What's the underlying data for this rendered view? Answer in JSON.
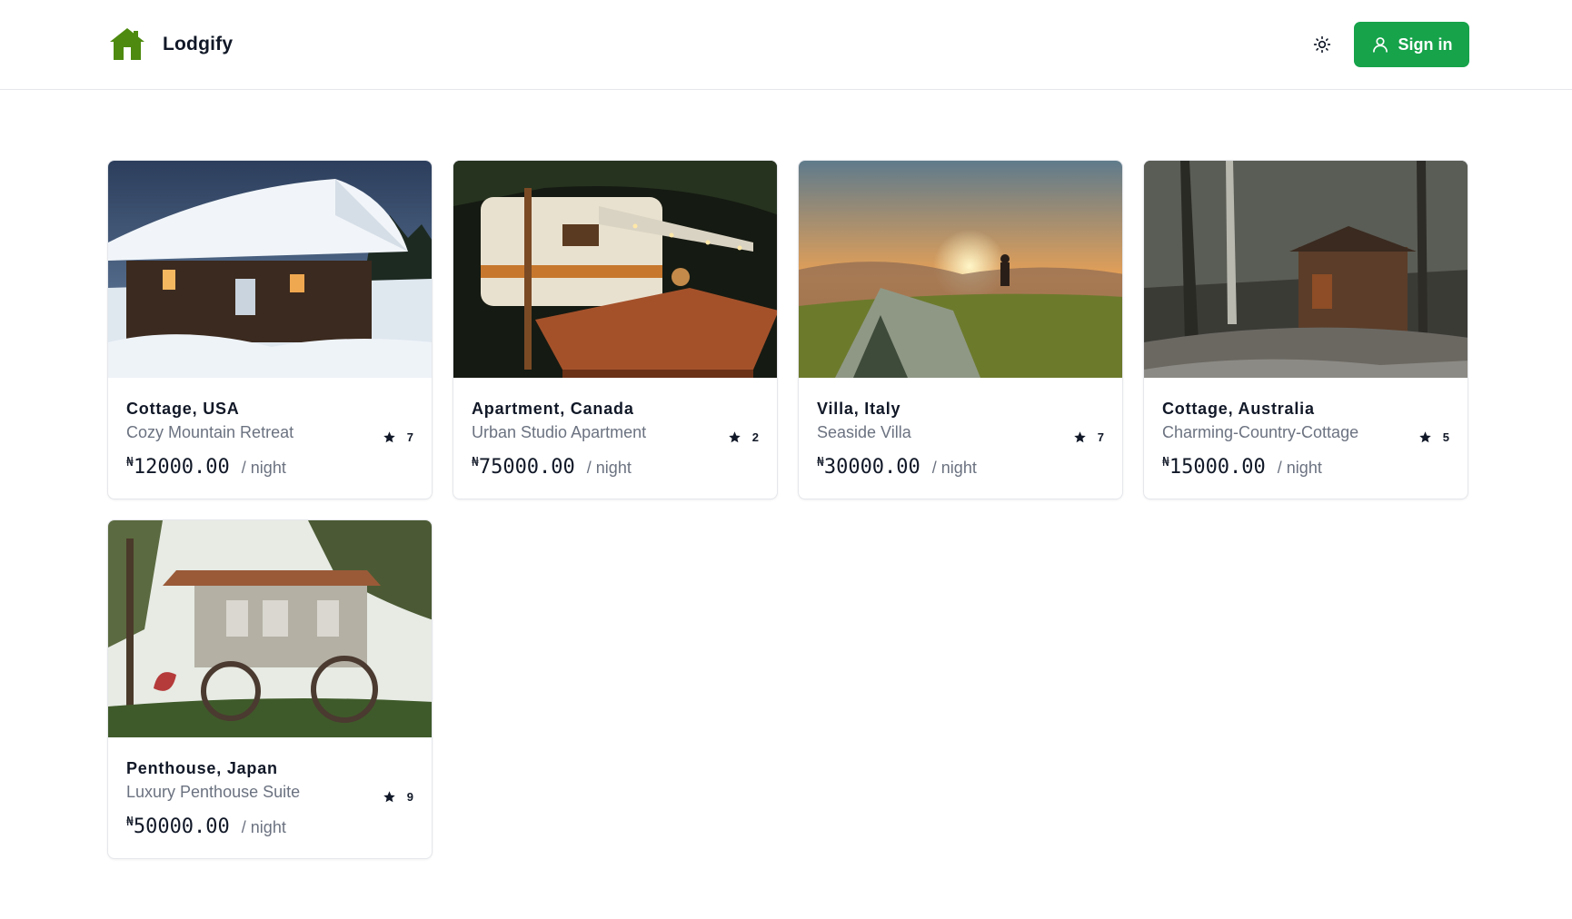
{
  "header": {
    "brand": "Lodgify",
    "signin_label": "Sign in",
    "accent_color": "#16a34a",
    "logo_icon": "house-icon",
    "theme_icon": "sun-icon",
    "user_icon": "user-icon"
  },
  "listings": [
    {
      "location": "Cottage, USA",
      "title": "Cozy Mountain Retreat",
      "currency": "₦",
      "price": "12000.00",
      "per": "/ night",
      "rating": "7",
      "photo": "snowy-cabin"
    },
    {
      "location": "Apartment, Canada",
      "title": "Urban Studio Apartment",
      "currency": "₦",
      "price": "75000.00",
      "per": "/ night",
      "rating": "2",
      "photo": "camper-night"
    },
    {
      "location": "Villa, Italy",
      "title": "Seaside Villa",
      "currency": "₦",
      "price": "30000.00",
      "per": "/ night",
      "rating": "7",
      "photo": "tent-sunset"
    },
    {
      "location": "Cottage, Australia",
      "title": "Charming-Country-Cottage",
      "currency": "₦",
      "price": "15000.00",
      "per": "/ night",
      "rating": "5",
      "photo": "forest-cabin"
    },
    {
      "location": "Penthouse, Japan",
      "title": "Luxury Penthouse Suite",
      "currency": "₦",
      "price": "50000.00",
      "per": "/ night",
      "rating": "9",
      "photo": "wagon-house"
    }
  ]
}
